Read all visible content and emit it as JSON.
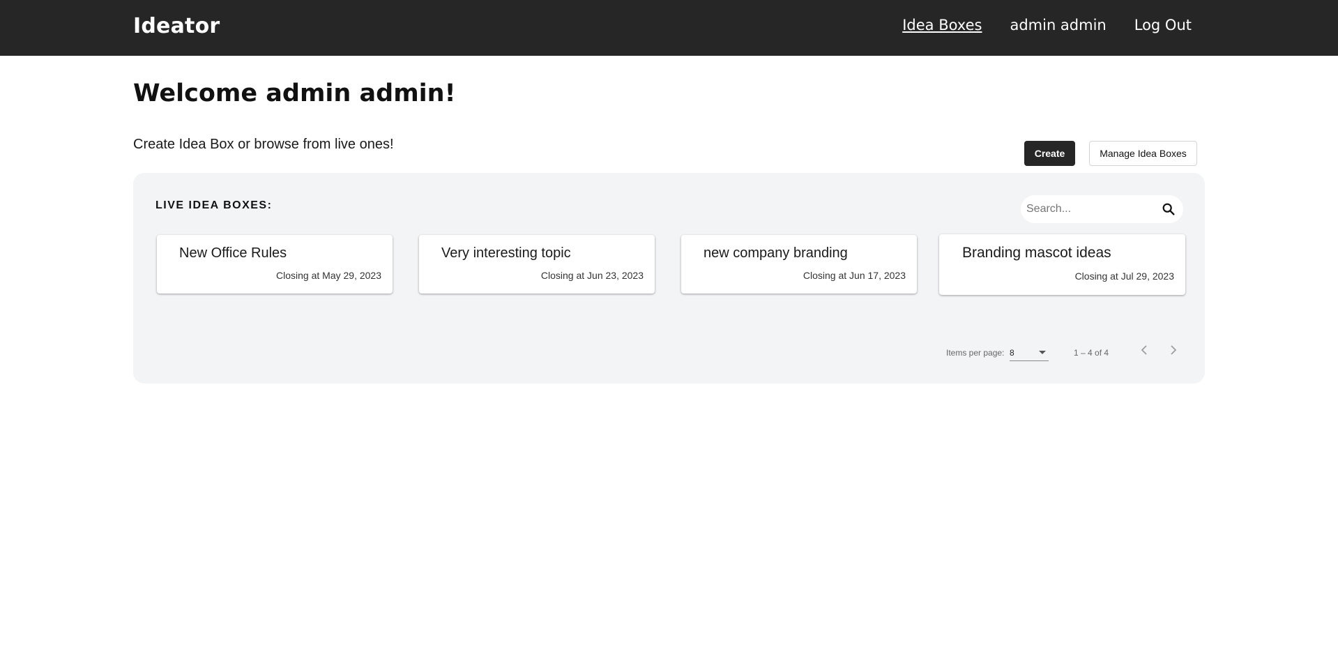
{
  "header": {
    "brand": "Ideator",
    "nav": {
      "idea_boxes": "Idea Boxes",
      "user": "admin admin",
      "logout": "Log Out"
    }
  },
  "main": {
    "welcome": "Welcome admin admin!",
    "subtitle": "Create Idea Box or browse from live ones!",
    "create_label": "Create",
    "manage_label": "Manage Idea Boxes"
  },
  "panel": {
    "title": "LIVE IDEA BOXES:",
    "search_placeholder": "Search...",
    "cards": [
      {
        "title": "New Office Rules",
        "closing": "Closing at May 29, 2023"
      },
      {
        "title": "Very interesting topic",
        "closing": "Closing at Jun 23, 2023"
      },
      {
        "title": "new company branding",
        "closing": "Closing at Jun 17, 2023"
      },
      {
        "title": "Branding mascot ideas",
        "closing": "Closing at Jul 29, 2023"
      }
    ],
    "paginator": {
      "items_per_page_label": "Items per page:",
      "items_per_page_value": "8",
      "range": "1 – 4 of 4"
    }
  },
  "icons": {
    "search": "search-icon",
    "prev": "chevron-left-icon",
    "next": "chevron-right-icon",
    "dropdown": "caret-down-icon"
  },
  "colors": {
    "topbar": "#262626",
    "panel": "#f3f4f6",
    "primary_button": "#262626"
  }
}
